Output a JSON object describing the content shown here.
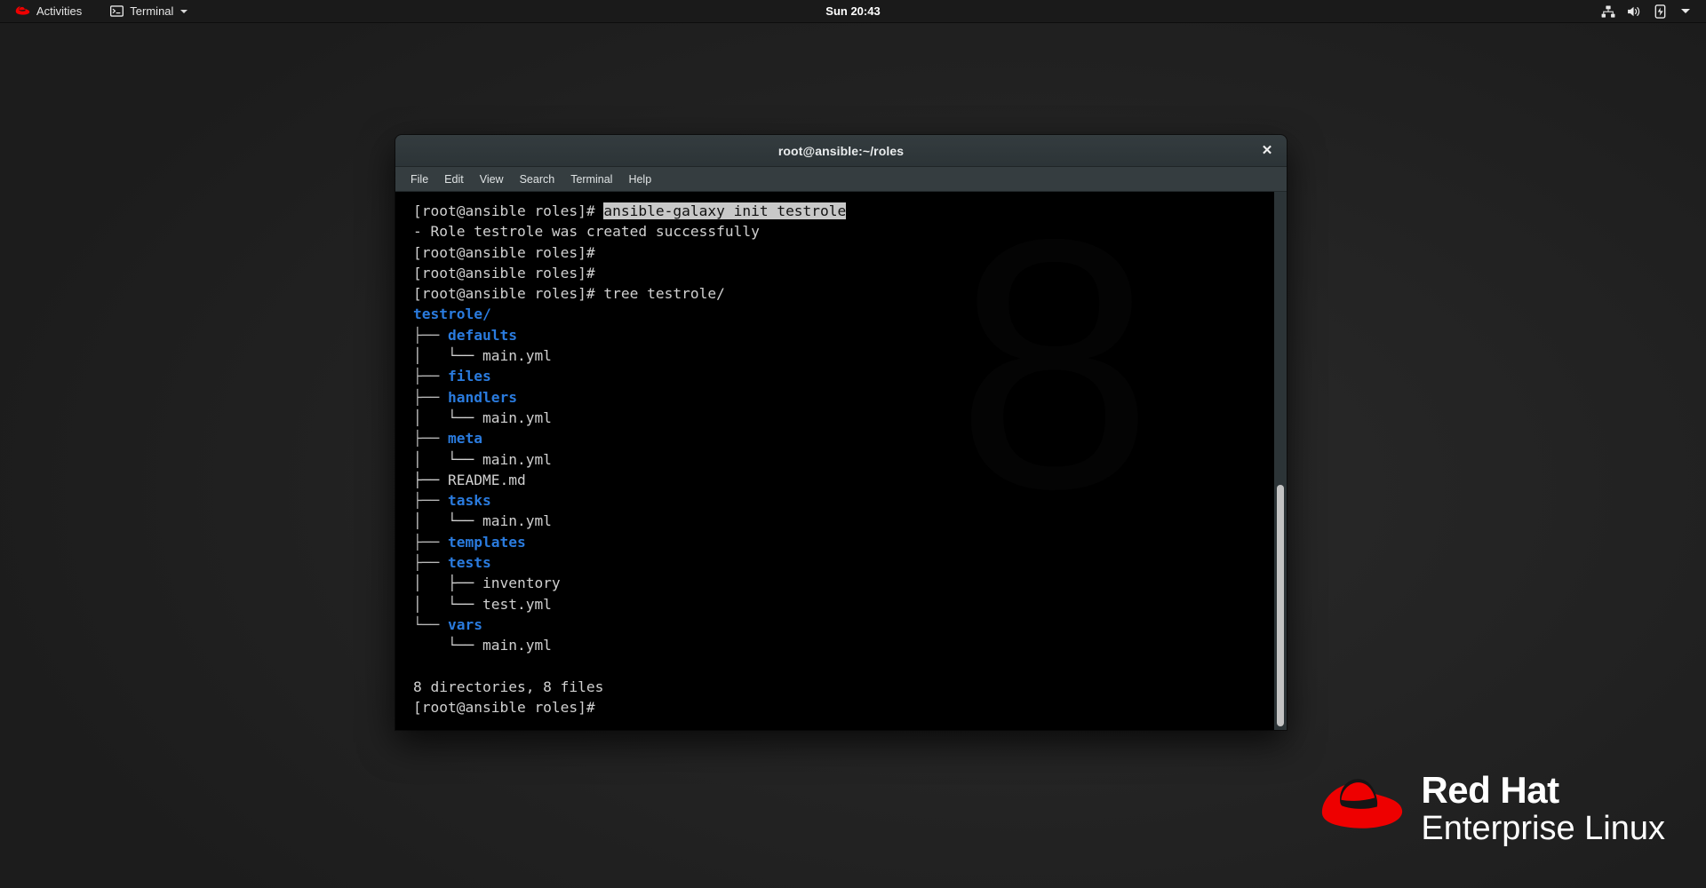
{
  "topbar": {
    "activities_label": "Activities",
    "app_label": "Terminal",
    "app_icon": "terminal-icon",
    "logo_icon": "redhat-logo-icon",
    "clock": "Sun 20:43",
    "tray": [
      {
        "name": "network-wired-icon",
        "label": "Network"
      },
      {
        "name": "volume-icon",
        "label": "Volume"
      },
      {
        "name": "battery-icon",
        "label": "Battery"
      },
      {
        "name": "chevron-down-icon",
        "label": "System menu"
      }
    ]
  },
  "window": {
    "title": "root@ansible:~/roles",
    "close_label": "✕",
    "menus": [
      "File",
      "Edit",
      "View",
      "Search",
      "Terminal",
      "Help"
    ]
  },
  "terminal": {
    "prompt": "[root@ansible roles]#",
    "lines": [
      {
        "segments": [
          {
            "text": "[root@ansible roles]# ",
            "style": "txt"
          },
          {
            "text": "ansible-galaxy init testrole",
            "style": "sel"
          }
        ]
      },
      {
        "segments": [
          {
            "text": "- Role testrole was created successfully",
            "style": "txt"
          }
        ]
      },
      {
        "segments": [
          {
            "text": "[root@ansible roles]#",
            "style": "txt"
          }
        ]
      },
      {
        "segments": [
          {
            "text": "[root@ansible roles]#",
            "style": "txt"
          }
        ]
      },
      {
        "segments": [
          {
            "text": "[root@ansible roles]# tree testrole/",
            "style": "txt"
          }
        ]
      },
      {
        "segments": [
          {
            "text": "testrole/",
            "style": "dir"
          }
        ]
      },
      {
        "segments": [
          {
            "text": "├── ",
            "style": "tree"
          },
          {
            "text": "defaults",
            "style": "dir"
          }
        ]
      },
      {
        "segments": [
          {
            "text": "│   └── main.yml",
            "style": "txt"
          }
        ]
      },
      {
        "segments": [
          {
            "text": "├── ",
            "style": "tree"
          },
          {
            "text": "files",
            "style": "dir"
          }
        ]
      },
      {
        "segments": [
          {
            "text": "├── ",
            "style": "tree"
          },
          {
            "text": "handlers",
            "style": "dir"
          }
        ]
      },
      {
        "segments": [
          {
            "text": "│   └── main.yml",
            "style": "txt"
          }
        ]
      },
      {
        "segments": [
          {
            "text": "├── ",
            "style": "tree"
          },
          {
            "text": "meta",
            "style": "dir"
          }
        ]
      },
      {
        "segments": [
          {
            "text": "│   └── main.yml",
            "style": "txt"
          }
        ]
      },
      {
        "segments": [
          {
            "text": "├── README.md",
            "style": "txt"
          }
        ]
      },
      {
        "segments": [
          {
            "text": "├── ",
            "style": "tree"
          },
          {
            "text": "tasks",
            "style": "dir"
          }
        ]
      },
      {
        "segments": [
          {
            "text": "│   └── main.yml",
            "style": "txt"
          }
        ]
      },
      {
        "segments": [
          {
            "text": "├── ",
            "style": "tree"
          },
          {
            "text": "templates",
            "style": "dir"
          }
        ]
      },
      {
        "segments": [
          {
            "text": "├── ",
            "style": "tree"
          },
          {
            "text": "tests",
            "style": "dir"
          }
        ]
      },
      {
        "segments": [
          {
            "text": "│   ├── inventory",
            "style": "txt"
          }
        ]
      },
      {
        "segments": [
          {
            "text": "│   └── test.yml",
            "style": "txt"
          }
        ]
      },
      {
        "segments": [
          {
            "text": "└── ",
            "style": "tree"
          },
          {
            "text": "vars",
            "style": "dir"
          }
        ]
      },
      {
        "segments": [
          {
            "text": "    └── main.yml",
            "style": "txt"
          }
        ]
      },
      {
        "segments": [
          {
            "text": "",
            "style": "txt"
          }
        ]
      },
      {
        "segments": [
          {
            "text": "8 directories, 8 files",
            "style": "txt"
          }
        ]
      },
      {
        "segments": [
          {
            "text": "[root@ansible roles]#",
            "style": "txt"
          }
        ]
      }
    ],
    "summary": {
      "directories": 8,
      "files": 8,
      "text": "8 directories, 8 files"
    },
    "commands": [
      "ansible-galaxy init testrole",
      "tree testrole/"
    ],
    "watermark": "8"
  },
  "branding": {
    "line1": "Red Hat",
    "line2": "Enterprise Linux"
  },
  "colors": {
    "accent_red": "#ee0000",
    "dir_blue": "#2a7bde",
    "terminal_bg": "#000000",
    "terminal_fg": "#d4d4d4",
    "titlebar_bg": "#2f373a",
    "desktop_bg": "#242424",
    "topbar_bg": "#1a1a1a"
  }
}
